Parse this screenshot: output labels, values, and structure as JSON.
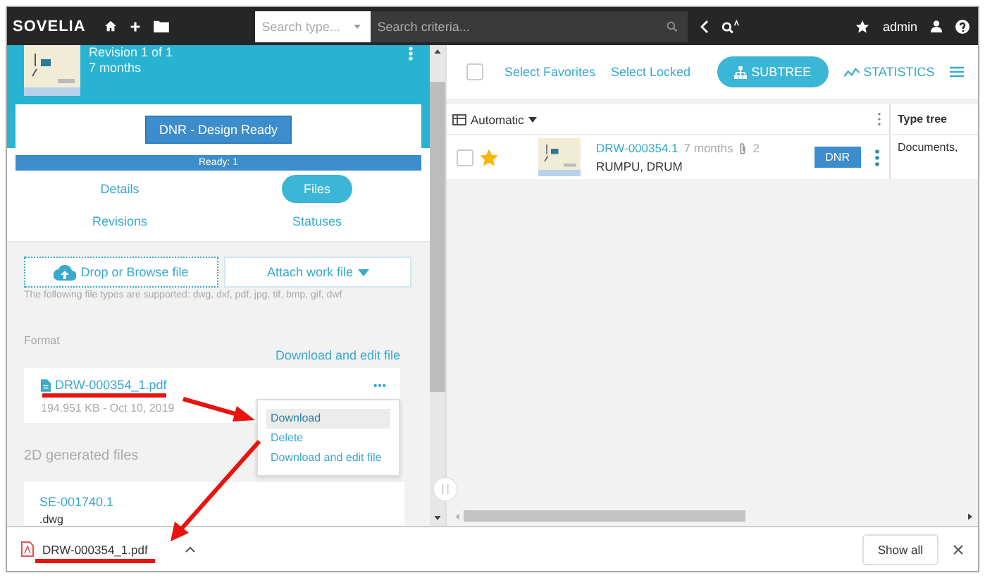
{
  "top_bar": {
    "logo": "SOVELIA",
    "search_type": {
      "placeholder": "Search type..."
    },
    "search_criteria": {
      "placeholder": "Search criteria..."
    },
    "user": "admin"
  },
  "item_header": {
    "revision": "Revision 1 of 1",
    "age": "7 months",
    "status_button": "DNR - Design Ready",
    "progress": {
      "label": "Ready: 1",
      "level": 1
    }
  },
  "tabs": [
    {
      "label": "Details",
      "selected": false
    },
    {
      "label": "Files",
      "selected": true
    },
    {
      "label": "Revisions",
      "selected": false
    },
    {
      "label": "Statuses",
      "selected": false
    }
  ],
  "files": {
    "drop_button": "Drop or Browse file",
    "attach_button": "Attach work file",
    "supported_note": "The following file types are supported: dwg, dxf, pdf, jpg, tif, bmp, gif, dwf",
    "format_heading": "Format",
    "download_edit_link": "Download and edit file",
    "file": {
      "name": "DRW-000354_1.pdf",
      "meta": "194.951 KB - Oct 10, 2019"
    },
    "context_menu": [
      {
        "label": "Download",
        "highlighted": true
      },
      {
        "label": "Delete",
        "highlighted": false
      },
      {
        "label": "Download and edit file",
        "highlighted": false
      }
    ],
    "generated_heading": "2D generated files",
    "generated_file": {
      "name": "SE-001740.1",
      "type": ".dwg"
    }
  },
  "toolbar": {
    "select_all_checked": false,
    "select_favorites": "Select Favorites",
    "select_locked": "Select Locked",
    "subtree": "SUBTREE",
    "statistics": "STATISTICS"
  },
  "results": {
    "view_mode": "Automatic",
    "columns": [
      "Type tree"
    ],
    "rows": [
      {
        "checked": false,
        "favorite": true,
        "id": "DRW-000354.1",
        "age": "7 months",
        "attachments": "2",
        "title": "RUMPU, DRUM",
        "status": "DNR",
        "type_tree": "Documents,"
      }
    ]
  },
  "download_bar": {
    "file": "DRW-000354_1.pdf",
    "show_all": "Show all"
  }
}
